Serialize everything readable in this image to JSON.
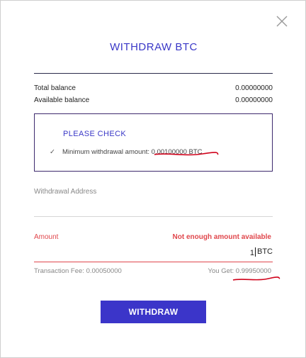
{
  "modal": {
    "title": "WITHDRAW BTC",
    "close_icon": "close-icon"
  },
  "balances": {
    "total_label": "Total balance",
    "total_value": "0.00000000",
    "available_label": "Available balance",
    "available_value": "0.00000000"
  },
  "notice": {
    "title": "PLEASE CHECK",
    "check_icon": "checkmark-icon",
    "min_label": "Minimum withdrawal amount: ",
    "min_value": "0.00100000 BTC"
  },
  "address": {
    "label": "Withdrawal Address",
    "value": ""
  },
  "amount": {
    "label": "Amount",
    "error": "Not enough amount available",
    "value": "1",
    "unit": "BTC"
  },
  "summary": {
    "fee_label": "Transaction Fee: ",
    "fee_value": "0.00050000",
    "get_label": "You Get: ",
    "get_value": "0.99950000"
  },
  "actions": {
    "withdraw_label": "WITHDRAW"
  },
  "colors": {
    "accent": "#3b35c9",
    "error": "#e0474c",
    "annotation": "#d0021b"
  }
}
